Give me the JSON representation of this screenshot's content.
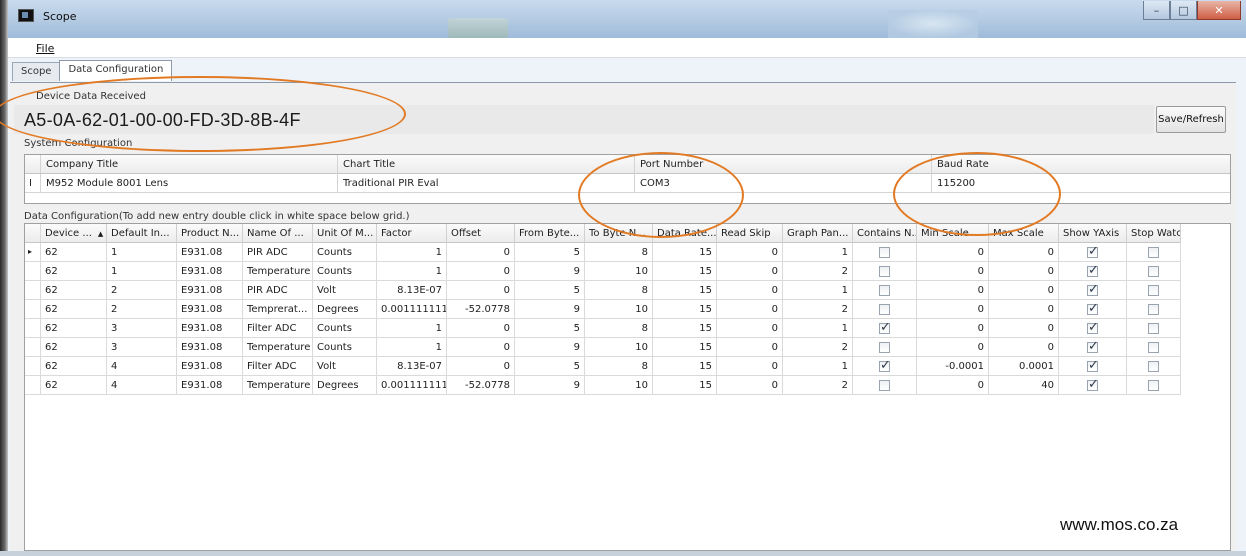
{
  "window": {
    "title": "Scope"
  },
  "menu": {
    "file": "File"
  },
  "tabs": [
    {
      "label": "Scope"
    },
    {
      "label": "Data Configuration"
    }
  ],
  "device": {
    "group_label": "Device Data Received",
    "value": "A5-0A-62-01-00-00-FD-3D-8B-4F",
    "save_label": "Save/Refresh"
  },
  "system": {
    "group_label": "System Configuration",
    "headers": [
      "Company Title",
      "Chart Title",
      "Port Number",
      "Baud Rate"
    ],
    "row": {
      "indicator": "I",
      "company_title": "M952 Module  8001 Lens",
      "chart_title": "Traditional PIR Eval",
      "port_number": "COM3",
      "baud_rate": "115200"
    }
  },
  "data_config": {
    "label": "Data Configuration(To add new entry double click in white space below grid.)",
    "headers": [
      "Device ...",
      "Default In...",
      "Product N...",
      "Name Of ...",
      "Unit Of M...",
      "Factor",
      "Offset",
      "From Byte...",
      "To Byte N...",
      "Data Rate...",
      "Read Skip",
      "Graph Pan...",
      "Contains N...",
      "Min Scale",
      "Max Scale",
      "Show YAxis",
      "Stop Watch"
    ],
    "sort_glyph": "▲",
    "current_row_glyph": "▸",
    "rows": [
      {
        "device": "62",
        "default_index": "1",
        "product": "E931.08",
        "name": "PIR ADC",
        "unit": "Counts",
        "factor": "1",
        "offset": "0",
        "from_byte": "5",
        "to_byte": "8",
        "data_rate": "15",
        "read_skip": "0",
        "graph_panel": "1",
        "contains_n": false,
        "min_scale": "0",
        "max_scale": "0",
        "show_yaxis": true,
        "stop_watch": false
      },
      {
        "device": "62",
        "default_index": "1",
        "product": "E931.08",
        "name": "Temperature",
        "unit": "Counts",
        "factor": "1",
        "offset": "0",
        "from_byte": "9",
        "to_byte": "10",
        "data_rate": "15",
        "read_skip": "0",
        "graph_panel": "2",
        "contains_n": false,
        "min_scale": "0",
        "max_scale": "0",
        "show_yaxis": true,
        "stop_watch": false
      },
      {
        "device": "62",
        "default_index": "2",
        "product": "E931.08",
        "name": "PIR ADC",
        "unit": "Volt",
        "factor": "8.13E-07",
        "offset": "0",
        "from_byte": "5",
        "to_byte": "8",
        "data_rate": "15",
        "read_skip": "0",
        "graph_panel": "1",
        "contains_n": false,
        "min_scale": "0",
        "max_scale": "0",
        "show_yaxis": true,
        "stop_watch": false
      },
      {
        "device": "62",
        "default_index": "2",
        "product": "E931.08",
        "name": "Temprerat...",
        "unit": "Degrees",
        "factor": "0.001111111",
        "offset": "-52.0778",
        "from_byte": "9",
        "to_byte": "10",
        "data_rate": "15",
        "read_skip": "0",
        "graph_panel": "2",
        "contains_n": false,
        "min_scale": "0",
        "max_scale": "0",
        "show_yaxis": true,
        "stop_watch": false
      },
      {
        "device": "62",
        "default_index": "3",
        "product": "E931.08",
        "name": "Filter ADC",
        "unit": "Counts",
        "factor": "1",
        "offset": "0",
        "from_byte": "5",
        "to_byte": "8",
        "data_rate": "15",
        "read_skip": "0",
        "graph_panel": "1",
        "contains_n": true,
        "min_scale": "0",
        "max_scale": "0",
        "show_yaxis": true,
        "stop_watch": false
      },
      {
        "device": "62",
        "default_index": "3",
        "product": "E931.08",
        "name": "Temperature",
        "unit": "Counts",
        "factor": "1",
        "offset": "0",
        "from_byte": "9",
        "to_byte": "10",
        "data_rate": "15",
        "read_skip": "0",
        "graph_panel": "2",
        "contains_n": false,
        "min_scale": "0",
        "max_scale": "0",
        "show_yaxis": true,
        "stop_watch": false
      },
      {
        "device": "62",
        "default_index": "4",
        "product": "E931.08",
        "name": "Filter ADC",
        "unit": "Volt",
        "factor": "8.13E-07",
        "offset": "0",
        "from_byte": "5",
        "to_byte": "8",
        "data_rate": "15",
        "read_skip": "0",
        "graph_panel": "1",
        "contains_n": true,
        "min_scale": "-0.0001",
        "max_scale": "0.0001",
        "show_yaxis": true,
        "stop_watch": false
      },
      {
        "device": "62",
        "default_index": "4",
        "product": "E931.08",
        "name": "Temperature",
        "unit": "Degrees",
        "factor": "0.001111111",
        "offset": "-52.0778",
        "from_byte": "9",
        "to_byte": "10",
        "data_rate": "15",
        "read_skip": "0",
        "graph_panel": "2",
        "contains_n": false,
        "min_scale": "0",
        "max_scale": "40",
        "show_yaxis": true,
        "stop_watch": false
      }
    ]
  },
  "watermark": "www.mos.co.za",
  "colors": {
    "annotation": "#e27a24",
    "titlebar": "#b7cde4",
    "grid_border": "#a0a0a0"
  }
}
